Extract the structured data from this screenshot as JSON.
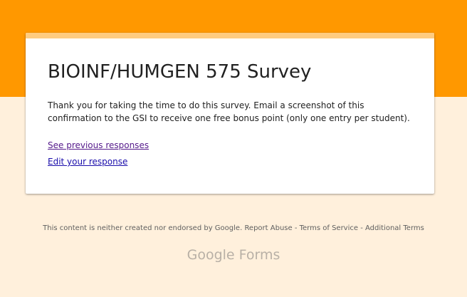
{
  "colors": {
    "header_band": "#ff9800",
    "card_accent": "#ffcc80",
    "page_background": "#fff0dc",
    "visited_link": "#551a8b",
    "link": "#1a0dab"
  },
  "form": {
    "title": "BIOINF/HUMGEN 575 Survey",
    "confirmation_message": "Thank you for taking the time to do this survey. Email a screenshot of this confirmation to the GSI to receive one free bonus point (only one entry per student).",
    "see_previous_label": "See previous responses",
    "edit_response_label": "Edit your response"
  },
  "footer": {
    "disclaimer": "This content is neither created nor endorsed by Google.",
    "report_abuse": "Report Abuse",
    "sep1": " - ",
    "terms_of_service": "Terms of Service",
    "sep2": " - ",
    "additional_terms": "Additional Terms"
  },
  "brand": {
    "logo_text": "Google Forms"
  }
}
